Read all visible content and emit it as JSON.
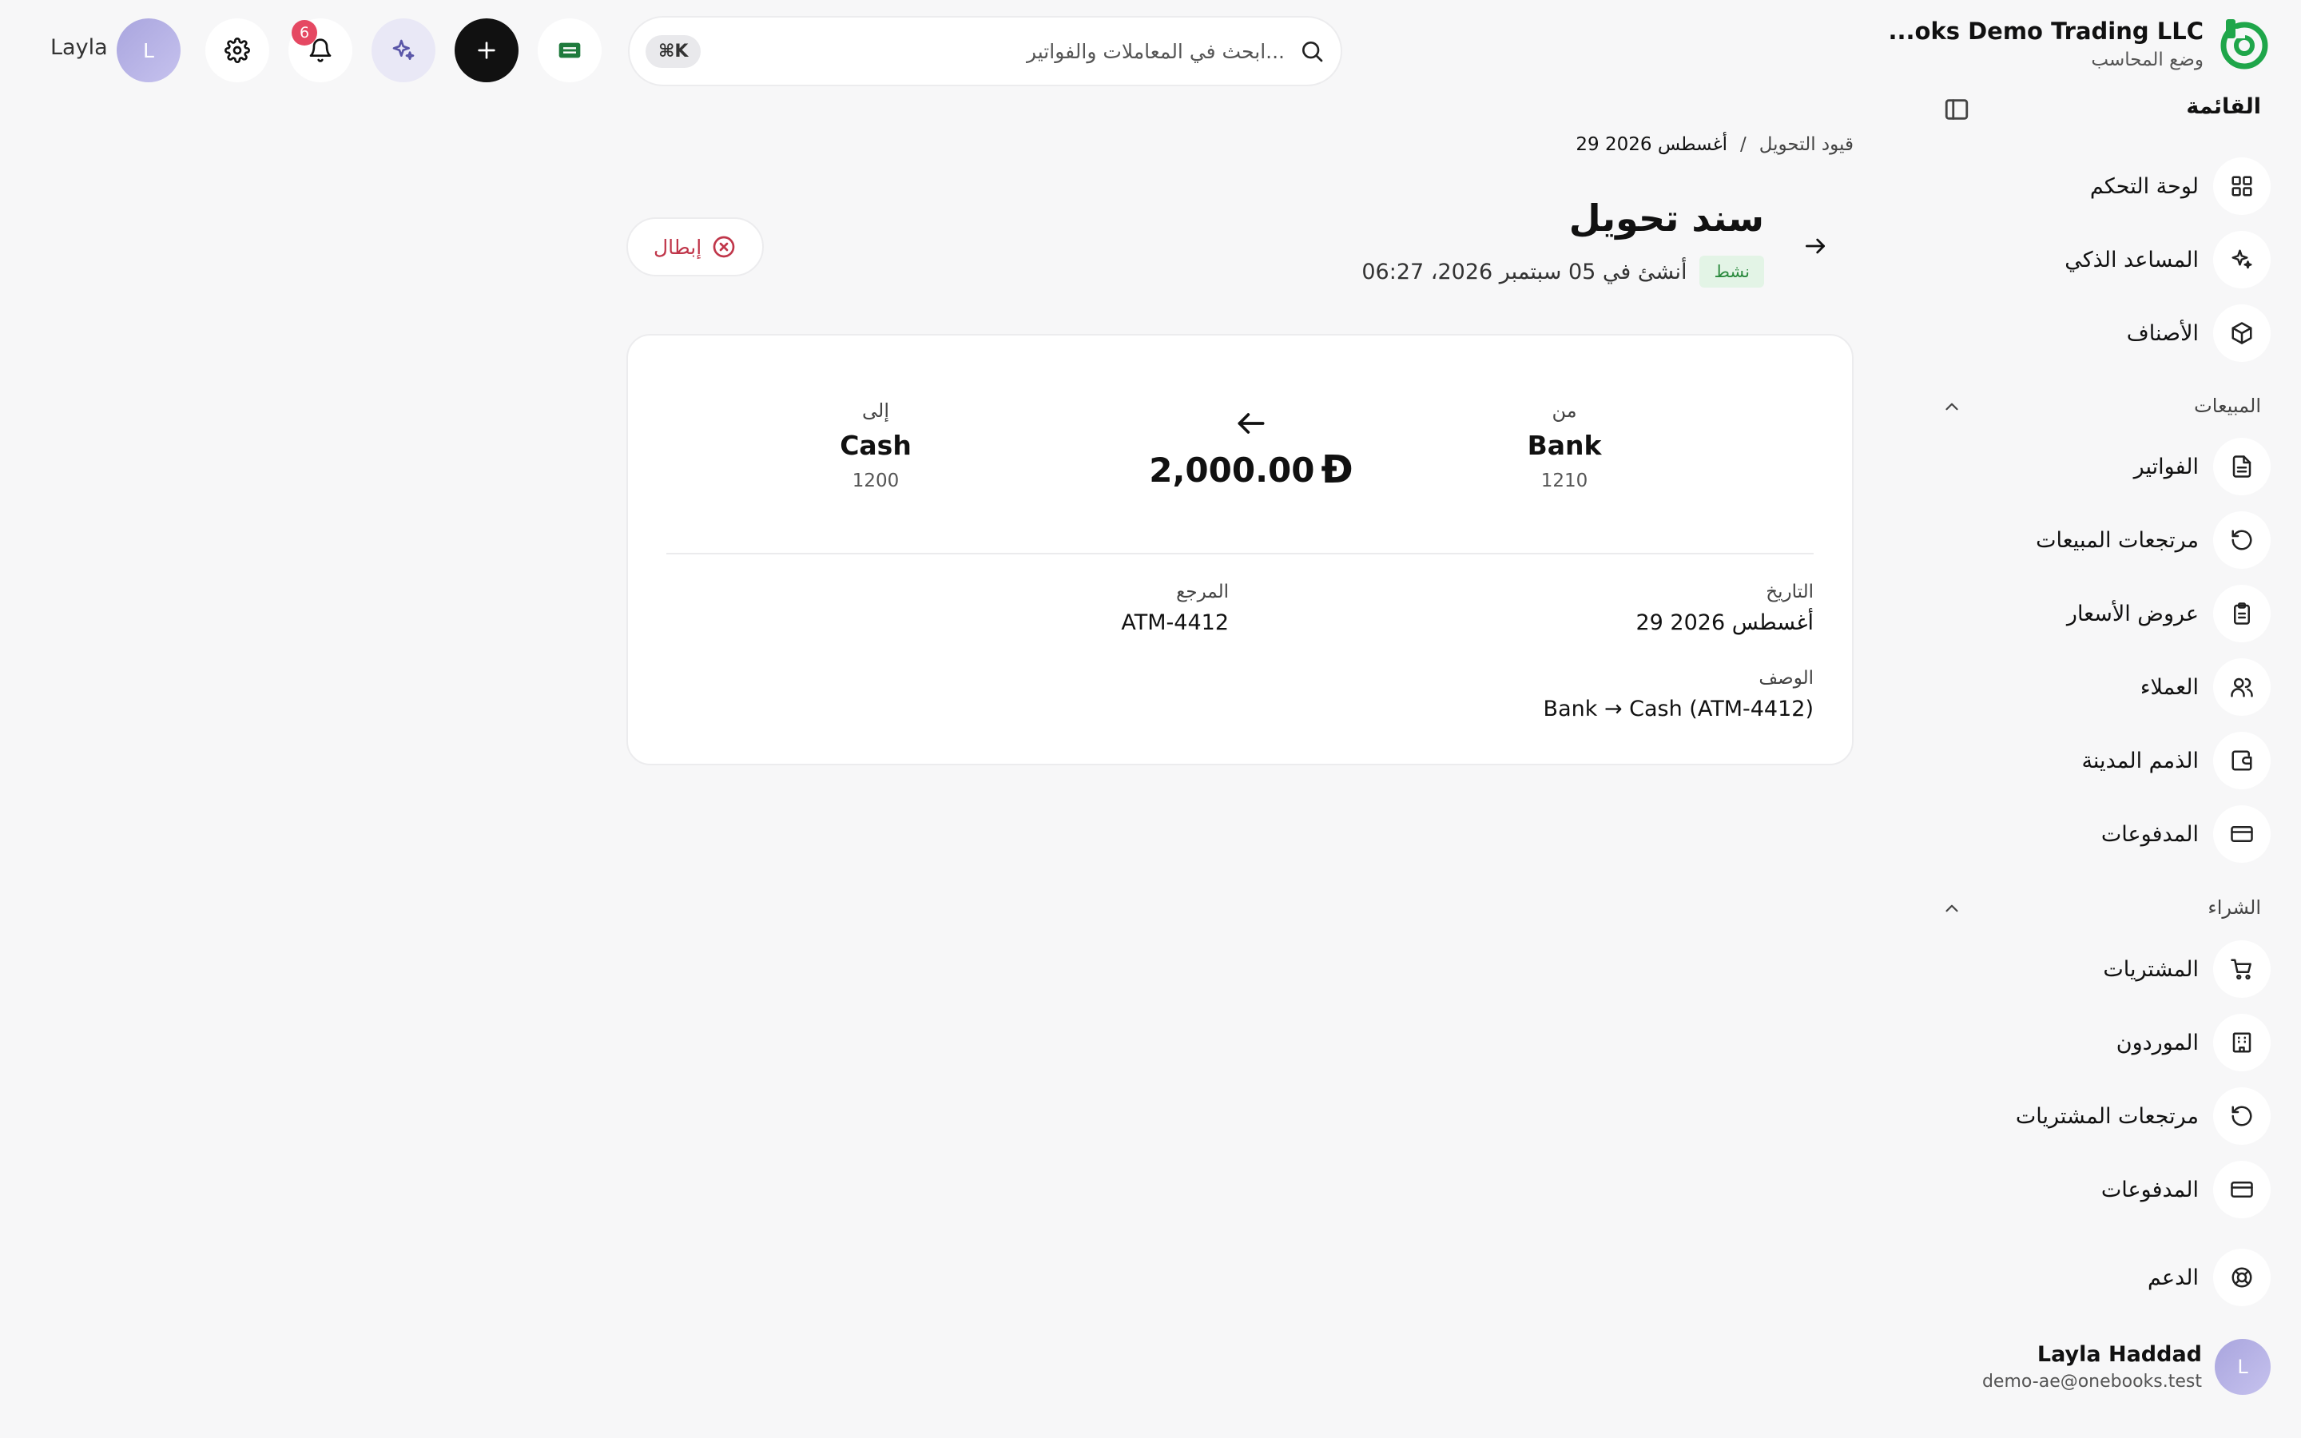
{
  "brand": {
    "name": "...oks Demo Trading LLC",
    "mode": "وضع المحاسب"
  },
  "sidebar": {
    "menu_title": "القائمة",
    "top_items": [
      {
        "label": "لوحة التحكم",
        "icon": "dashboard-icon"
      },
      {
        "label": "المساعد الذكي",
        "icon": "sparkles-icon"
      },
      {
        "label": "الأصناف",
        "icon": "box-icon"
      }
    ],
    "sales": {
      "title": "المبيعات",
      "items": [
        {
          "label": "الفواتير",
          "icon": "invoice-icon"
        },
        {
          "label": "مرتجعات المبيعات",
          "icon": "undo-icon"
        },
        {
          "label": "عروض الأسعار",
          "icon": "clipboard-icon"
        },
        {
          "label": "العملاء",
          "icon": "users-icon"
        },
        {
          "label": "الذمم المدينة",
          "icon": "wallet-icon"
        },
        {
          "label": "المدفوعات",
          "icon": "card-icon"
        }
      ]
    },
    "purchases": {
      "title": "الشراء",
      "items": [
        {
          "label": "المشتريات",
          "icon": "cart-icon"
        },
        {
          "label": "الموردون",
          "icon": "building-icon"
        },
        {
          "label": "مرتجعات المشتريات",
          "icon": "undo-icon"
        },
        {
          "label": "المدفوعات",
          "icon": "card-icon"
        }
      ]
    },
    "support": {
      "label": "الدعم",
      "icon": "lifebuoy-icon"
    },
    "user": {
      "name": "Layla Haddad",
      "email": "demo-ae@onebooks.test",
      "initial": "L"
    }
  },
  "topbar": {
    "search_placeholder": "ابحث في المعاملات والفواتير...",
    "shortcut": "⌘K",
    "notifications_count": "6",
    "user_initial": "L",
    "user_name": "Layla"
  },
  "breadcrumb": {
    "parent": "قيود التحويل",
    "separator": "/",
    "current": "29 أغسطس 2026"
  },
  "page": {
    "title": "سند تحويل",
    "status": "نشط",
    "created": "أنشئ في 05 سبتمبر 2026، 06:27",
    "void_label": "إبطال"
  },
  "transfer": {
    "from_label": "من",
    "from_name": "Bank",
    "from_code": "1210",
    "to_label": "إلى",
    "to_name": "Cash",
    "to_code": "1200",
    "amount": "2,000.00",
    "currency_symbol": "Đ",
    "date_label": "التاريخ",
    "date_value": "29 أغسطس 2026",
    "ref_label": "المرجع",
    "ref_value": "ATM-4412",
    "desc_label": "الوصف",
    "desc_value": "Bank → Cash (ATM-4412)"
  },
  "colors": {
    "accent_green": "#1fa64a",
    "danger": "#c0364a",
    "badge": "#e54862",
    "status_bg": "#e3f4e6"
  }
}
